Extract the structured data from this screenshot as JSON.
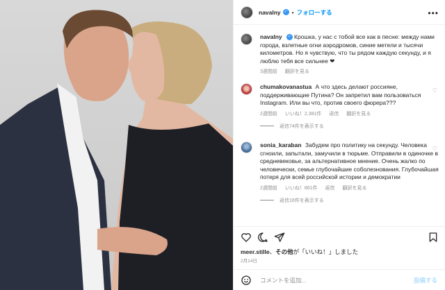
{
  "header": {
    "username": "navalny",
    "separator": "•",
    "follow_label": "フォローする",
    "more_label": "•••"
  },
  "caption": {
    "username": "navalny",
    "text": "Крошка, у нас с тобой все как в песне: между нами города, взлетные огни аэродромов, синие метели и тысячи километров. Но я чувствую, что ты рядом каждую секунду, и я люблю тебя все сильнее ❤",
    "time": "3週間前",
    "translate": "翻訳を見る"
  },
  "comments": [
    {
      "username": "chumakovanastua",
      "text": "А что здесь делают россияне, поддерживающие Путина? Он запретил вам пользоваться Instagram. Или вы что, против своего фюрера???",
      "time": "2週間前",
      "likes": "いいね！2,381件",
      "reply": "返信",
      "translate": "翻訳を見る",
      "replies_label": "返信74件を表示する"
    },
    {
      "username": "sonia_karaban",
      "text": "Забудем про политику на секунду. Человека сгноили, запытали, замучили в тюрьме. Отправили в одиночке в средневековье, за альтернативное мнение. Очень жалко по человечески, семье глубочайшие соболезнования. Глубочайшая потеря для всей российской истории и демократии",
      "time": "2週間前",
      "likes": "いいね！861件",
      "reply": "返信",
      "translate": "翻訳を見る",
      "replies_label": "返信16件を表示する"
    }
  ],
  "likes_line": {
    "user": "meer.stille",
    "and": "、",
    "others": "その他",
    "suffix": "が「いいね！」しました"
  },
  "date": "2月14日",
  "add_comment": {
    "placeholder": "コメントを追加...",
    "post_label": "投稿する"
  },
  "colors": {
    "accent": "#0095f6",
    "verified": "#3897f0",
    "muted": "#8e8e8e"
  },
  "icons": [
    "heart-icon",
    "comment-icon",
    "share-icon",
    "bookmark-icon",
    "emoji-icon",
    "more-icon",
    "verified-icon"
  ]
}
